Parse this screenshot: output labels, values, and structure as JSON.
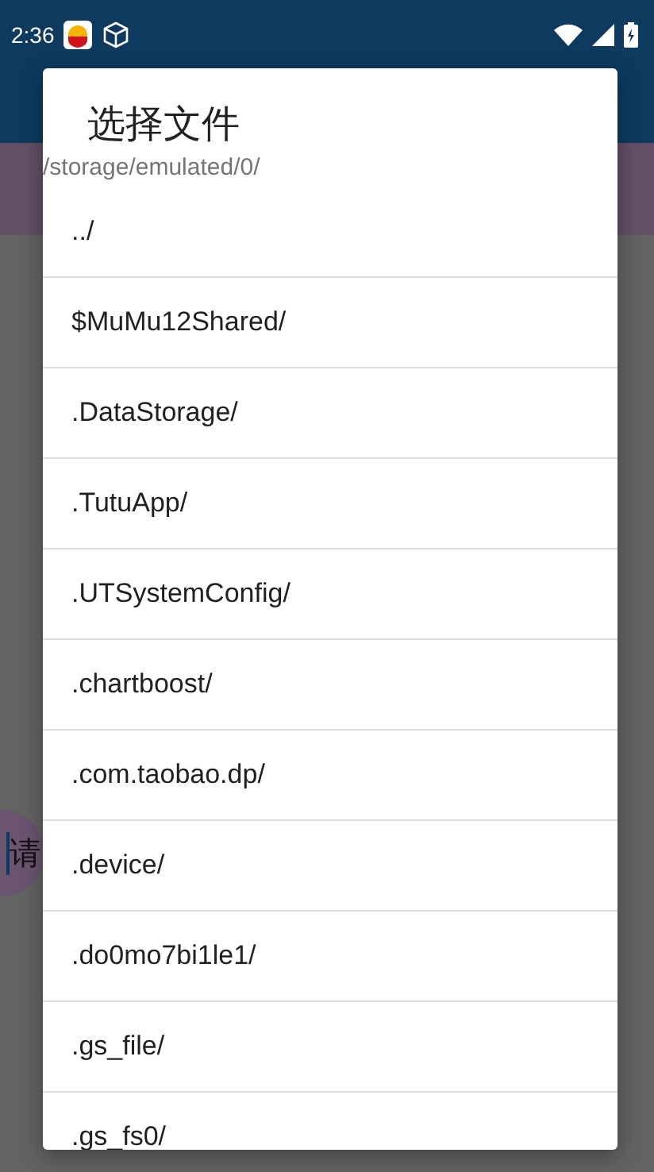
{
  "status_bar": {
    "time": "2:36"
  },
  "background": {
    "button_label": "请"
  },
  "dialog": {
    "title": "选择文件",
    "path": "/storage/emulated/0/",
    "items": [
      {
        "name": "../"
      },
      {
        "name": "$MuMu12Shared/"
      },
      {
        "name": ".DataStorage/"
      },
      {
        "name": ".TutuApp/"
      },
      {
        "name": ".UTSystemConfig/"
      },
      {
        "name": ".chartboost/"
      },
      {
        "name": ".com.taobao.dp/"
      },
      {
        "name": ".device/"
      },
      {
        "name": ".do0mo7bi1le1/"
      },
      {
        "name": ".gs_file/"
      },
      {
        "name": ".gs_fs0/"
      }
    ]
  }
}
